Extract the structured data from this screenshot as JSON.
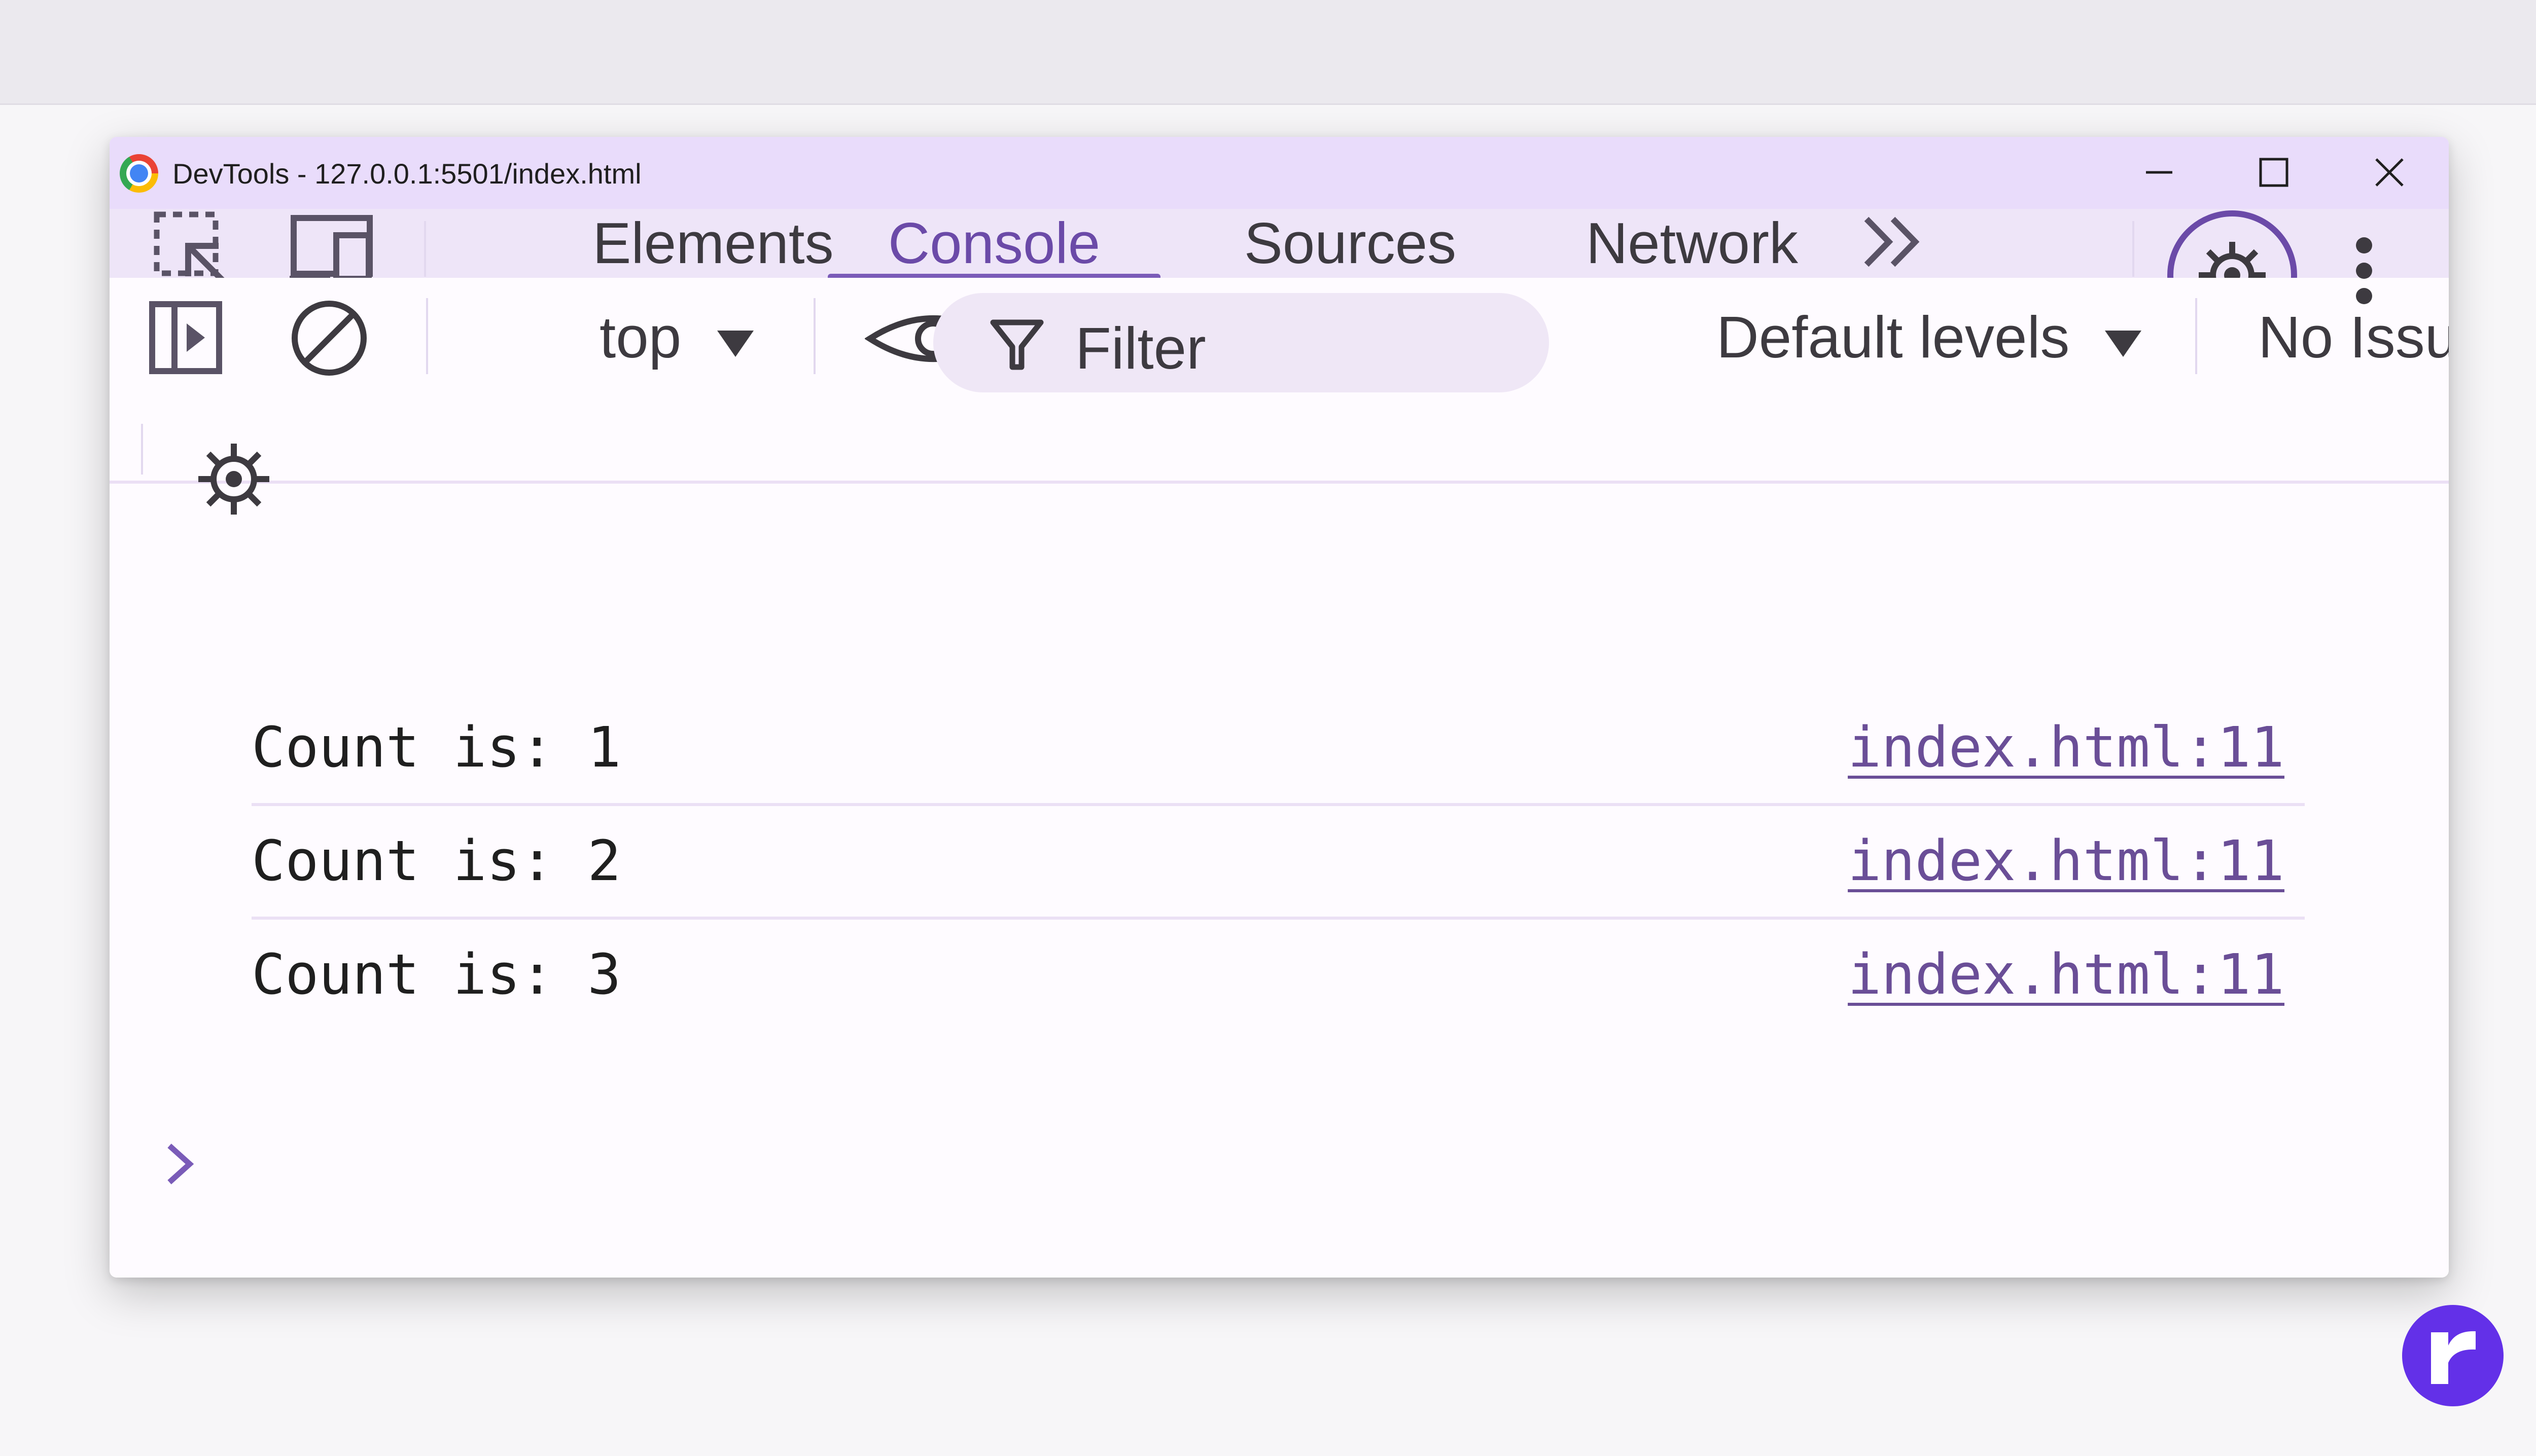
{
  "window": {
    "title": "DevTools - 127.0.0.1:5501/index.html",
    "controls": {
      "minimize_icon": "minimize-icon",
      "maximize_icon": "maximize-icon",
      "close_icon": "close-icon"
    }
  },
  "tabs": [
    {
      "label": "Elements",
      "active": false
    },
    {
      "label": "Console",
      "active": true
    },
    {
      "label": "Sources",
      "active": false
    },
    {
      "label": "Network",
      "active": false
    }
  ],
  "tab_icons": {
    "inspect": "select-element-icon",
    "device": "device-toolbar-icon",
    "more_tabs": "double-chevron-right-icon",
    "settings": "gear-icon",
    "menu": "kebab-menu-icon"
  },
  "console_toolbar": {
    "context_select": "top",
    "filter_placeholder": "Filter",
    "levels_select": "Default levels",
    "issues_label": "No Issues"
  },
  "console_messages": [
    {
      "text": "Count is: 1",
      "source": "index.html:11"
    },
    {
      "text": "Count is: 2",
      "source": "index.html:11"
    },
    {
      "text": "Count is: 3",
      "source": "index.html:11"
    }
  ],
  "colors": {
    "accent": "#7a5bb8",
    "titlebar": "#e9dcfb",
    "link": "#6a4e97",
    "badge": "#6330e8"
  }
}
